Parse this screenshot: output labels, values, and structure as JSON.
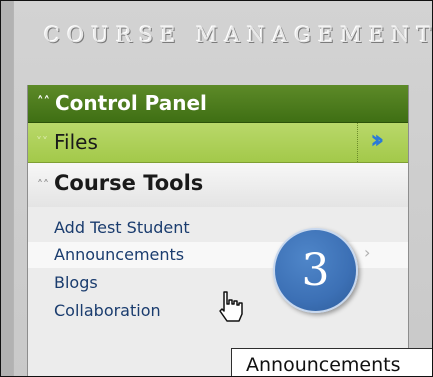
{
  "header": {
    "title": "COURSE MANAGEMENT"
  },
  "control_panel": {
    "label": "Control Panel",
    "chevron_icon": "double-chevron-up"
  },
  "files": {
    "label": "Files",
    "chevron_icon": "double-chevron-down",
    "expand_icon": "double-chevron-right"
  },
  "course_tools": {
    "label": "Course Tools",
    "chevron_icon": "double-chevron-up",
    "items": [
      {
        "label": "Add Test Student"
      },
      {
        "label": "Announcements"
      },
      {
        "label": "Blogs"
      },
      {
        "label": "Collaboration"
      }
    ]
  },
  "step_badge": {
    "number": "3"
  },
  "tooltip": {
    "text": "Announcements"
  },
  "colors": {
    "control_panel_bar": "#4a7a1e",
    "files_bar": "#acd058",
    "badge": "#3c70b5",
    "expand_arrow": "#2a79d8"
  }
}
